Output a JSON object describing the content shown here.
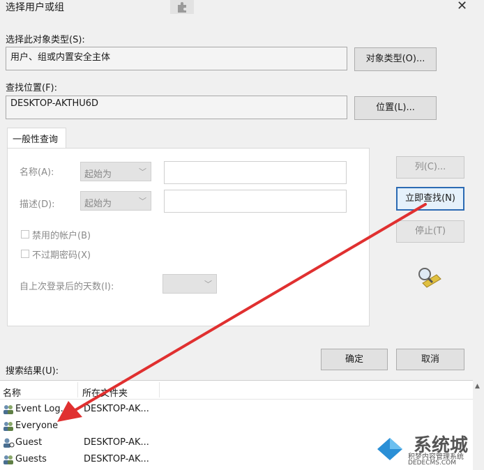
{
  "window": {
    "title": "选择用户或组",
    "close_glyph": "✕"
  },
  "object_type": {
    "label": "选择此对象类型(S):",
    "value": "用户、组或内置安全主体",
    "button": "对象类型(O)..."
  },
  "location": {
    "label": "查找位置(F):",
    "value": "DESKTOP-AKTHU6D",
    "button": "位置(L)..."
  },
  "query": {
    "tab": "一般性查询",
    "name_label": "名称(A):",
    "name_mode": "起始为",
    "desc_label": "描述(D):",
    "desc_mode": "起始为",
    "disabled_accounts": "禁用的帐户(B)",
    "no_expire": "不过期密码(X)",
    "days_label": "自上次登录后的天数(I):"
  },
  "side_buttons": {
    "columns": "列(C)...",
    "find_now": "立即查找(N)",
    "stop": "停止(T)"
  },
  "footer": {
    "ok": "确定",
    "cancel": "取消"
  },
  "results": {
    "label": "搜索结果(U):",
    "columns": [
      "名称",
      "所在文件夹"
    ],
    "rows": [
      {
        "name": "Event Log...",
        "folder": "DESKTOP-AK..."
      },
      {
        "name": "Everyone",
        "folder": ""
      },
      {
        "name": "Guest",
        "folder": "DESKTOP-AK..."
      },
      {
        "name": "Guests",
        "folder": "DESKTOP-AK..."
      }
    ]
  },
  "watermark": {
    "line1": "积梦内容管理系统",
    "line2": "DEDECMS.COM",
    "brand": "系统城"
  },
  "colors": {
    "arrow": "#e03030",
    "default_button_border": "#2b6ab3"
  }
}
